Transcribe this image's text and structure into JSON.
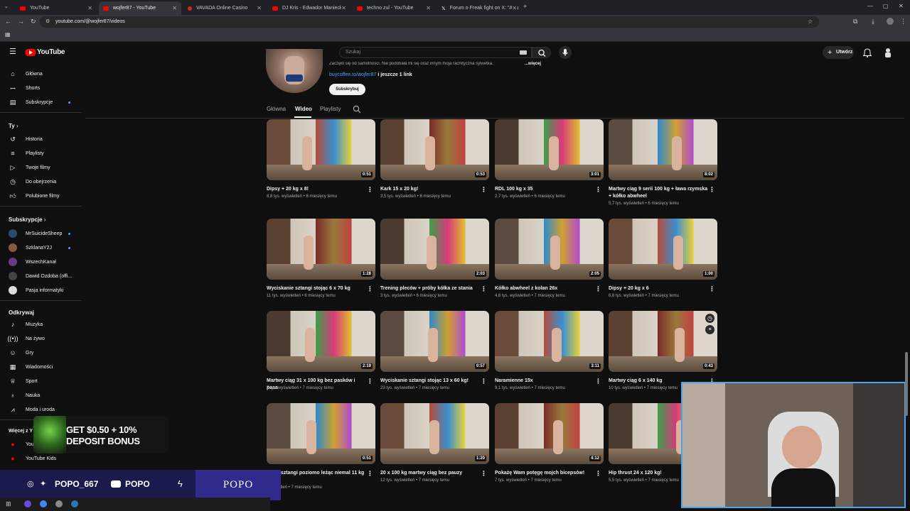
{
  "browser": {
    "tabs": [
      {
        "title": "YouTube",
        "active": false
      },
      {
        "title": "wojfer87 - YouTube",
        "active": true
      },
      {
        "title": "VAVADA Online Casino",
        "active": false
      },
      {
        "title": "DJ Kris - Edwador Maniecki | ",
        "active": false
      },
      {
        "title": "techno zul - YouTube",
        "active": false
      },
      {
        "title": "Forum o Freak fight on X: \"Artu",
        "active": false
      }
    ],
    "url": "youtube.com/@wojfer87/videos",
    "new_tab": "+"
  },
  "header": {
    "logo_text": "YouTube",
    "search_placeholder": "Szukaj",
    "create_label": "Utwórz"
  },
  "sidebar": {
    "main": [
      {
        "label": "Główna",
        "icon": "home-icon"
      },
      {
        "label": "Shorts",
        "icon": "shorts-icon"
      },
      {
        "label": "Subskrypcje",
        "icon": "subscriptions-icon"
      }
    ],
    "you_title": "Ty",
    "you": [
      {
        "label": "Historia",
        "icon": "history-icon"
      },
      {
        "label": "Playlisty",
        "icon": "playlist-icon"
      },
      {
        "label": "Twoje filmy",
        "icon": "video-icon"
      },
      {
        "label": "Do obejrzenia",
        "icon": "clock-icon"
      },
      {
        "label": "Polubione filmy",
        "icon": "like-icon"
      }
    ],
    "subs_title": "Subskrypcje",
    "subs": [
      {
        "label": "MrSuicideSheep",
        "color": "#2b4a6f",
        "dot": true
      },
      {
        "label": "SzklanaY2J",
        "color": "#8a5a3a",
        "dot": true
      },
      {
        "label": "WszechKanał",
        "color": "#6a3a8a",
        "dot": false
      },
      {
        "label": "Dawid Ozdoba (offi...",
        "color": "#444444",
        "dot": false
      },
      {
        "label": "Pasja informatyki",
        "color": "#dddddd",
        "dot": false
      }
    ],
    "explore_title": "Odkrywaj",
    "explore": [
      {
        "label": "Muzyka",
        "icon": "music-icon"
      },
      {
        "label": "Na żywo",
        "icon": "live-icon"
      },
      {
        "label": "Gry",
        "icon": "gaming-icon"
      },
      {
        "label": "Wiadomości",
        "icon": "news-icon"
      },
      {
        "label": "Sport",
        "icon": "trophy-icon"
      },
      {
        "label": "Nauka",
        "icon": "bulb-icon"
      },
      {
        "label": "Moda i uroda",
        "icon": "hanger-icon"
      }
    ],
    "more_title": "Więcej z Y",
    "more": [
      {
        "label": "You",
        "icon": "yt-icon"
      },
      {
        "label": "YouTube Kids",
        "icon": "yt-kids-icon"
      }
    ]
  },
  "channel": {
    "desc": "Zaczęło się od samotności. Nie podobała mi się oraz innym moja rachityczna sylwetka.",
    "more": "...więcej",
    "link": "buycoffee.to/wojfer87",
    "link_more": "i jeszcze 1 link",
    "subscribe": "Subskrybuj",
    "tabs": [
      "Główna",
      "Wideo",
      "Playlisty"
    ],
    "active_tab": "Wideo"
  },
  "videos": [
    {
      "title": "Dipsy + 20 kg x 8!",
      "meta": "8,8 tys. wyświetleń • 6 miesięcy temu",
      "duration": "0:51"
    },
    {
      "title": "Kark 15 x 20 kg!",
      "meta": "3,5 tys. wyświetleń • 6 miesięcy temu",
      "duration": "0:53"
    },
    {
      "title": "RDL 100 kg x 35",
      "meta": "2,7 tys. wyświetleń • 6 miesięcy temu",
      "duration": "3:01"
    },
    {
      "title": "Martwy ciąg 9 serii 100 kg + ława rzymska + kółko abwheel",
      "meta": "5,7 tys. wyświetleń • 6 miesięcy temu",
      "duration": "8:02"
    },
    {
      "title": "Wyciskanie sztangi stojąc 6 x 70 kg",
      "meta": "11 tys. wyświetleń • 6 miesięcy temu",
      "duration": "1:28"
    },
    {
      "title": "Trening pleców + próby kółka ze stania",
      "meta": "3 tys. wyświetleń • 6 miesięcy temu",
      "duration": "2:03"
    },
    {
      "title": "Kółko abwheel z kolan 26x",
      "meta": "4,6 tys. wyświetleń • 7 miesięcy temu",
      "duration": "2:05"
    },
    {
      "title": "Dipsy + 20 kg x 6",
      "meta": "6,6 tys. wyświetleń • 7 miesięcy temu",
      "duration": "1:00"
    },
    {
      "title": "Martwy ciąg 31 x 100 kg bez pasków i pasa",
      "meta": "7 tys. wyświetleń • 7 miesięcy temu",
      "duration": "2:19"
    },
    {
      "title": "Wyciskanie sztangi stojąc 13 x 60 kg!",
      "meta": "23 tys. wyświetleń • 7 miesięcy temu",
      "duration": "0:57"
    },
    {
      "title": "Naramienne 15x",
      "meta": "9,1 tys. wyświetleń • 7 miesięcy temu",
      "duration": "3:11"
    },
    {
      "title": "Martwy ciąg 6 x 140 kg",
      "meta": "10 tys. wyświetleń • 7 miesięcy temu",
      "duration": "0:43"
    },
    {
      "title": "kanie sztangi poziomo leżąc niemal 11 kg",
      "meta": "wyświetleń • 7 miesięcy temu",
      "duration": "0:51"
    },
    {
      "title": "20 x 100 kg martwy ciąg bez pauzy",
      "meta": "12 tys. wyświetleń • 7 miesięcy temu",
      "duration": "1:20"
    },
    {
      "title": "Pokażę Wam potęgę mojch bicepsów!",
      "meta": "7 tys. wyświetleń • 7 miesięcy temu",
      "duration": "4:12"
    },
    {
      "title": "Hip thrust 24 x 120 kg!",
      "meta": "5,5 tys. wyświetleń • 7 miesięcy temu",
      "duration": ""
    }
  ],
  "ad": {
    "line1": "GET $0.50 + 10%",
    "line2": "DEPOSIT BONUS"
  },
  "stream": {
    "handle1": "POPO_667",
    "handle2": "POPO",
    "brand": "POPO"
  }
}
